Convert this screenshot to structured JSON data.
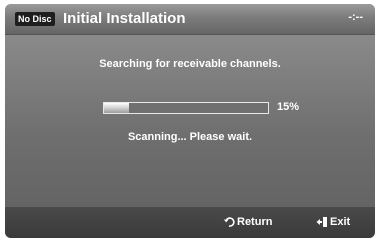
{
  "header": {
    "disc_badge": "No Disc",
    "title": "Initial Installation",
    "clock": "-:--"
  },
  "main": {
    "message": "Searching for receivable channels.",
    "progress_percent": 15,
    "progress_label": "15%",
    "status": "Scanning... Please wait."
  },
  "footer": {
    "return_label": "Return",
    "return_icon": "return-arrow-icon",
    "exit_label": "Exit",
    "exit_icon": "exit-door-icon"
  },
  "colors": {
    "header": "#7c7c7c",
    "body": "#6f6f6f",
    "footer": "#3e3e3e",
    "text": "#ffffff"
  }
}
